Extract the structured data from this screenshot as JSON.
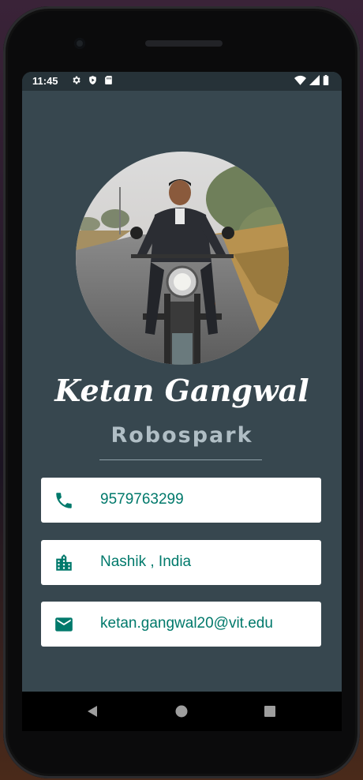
{
  "status_bar": {
    "time": "11:45",
    "left_icons": [
      "gear-icon",
      "shield-play-icon",
      "sim-card-icon"
    ],
    "right_icons": [
      "wifi-icon",
      "signal-icon",
      "battery-icon"
    ]
  },
  "profile": {
    "name": "Ketan Gangwal",
    "company": "Robospark"
  },
  "contacts": [
    {
      "icon": "phone-icon",
      "value": "9579763299"
    },
    {
      "icon": "location-city-icon",
      "value": "Nashik , India"
    },
    {
      "icon": "email-icon",
      "value": "ketan.gangwal20@vit.edu"
    }
  ],
  "nav_bar": {
    "buttons": [
      "back-icon",
      "home-icon",
      "recents-icon"
    ]
  },
  "colors": {
    "screen_background": "#37474f",
    "status_bar": "#263238",
    "accent_teal": "#00796b",
    "card_background": "#ffffff",
    "subtitle": "#b0bec5"
  }
}
